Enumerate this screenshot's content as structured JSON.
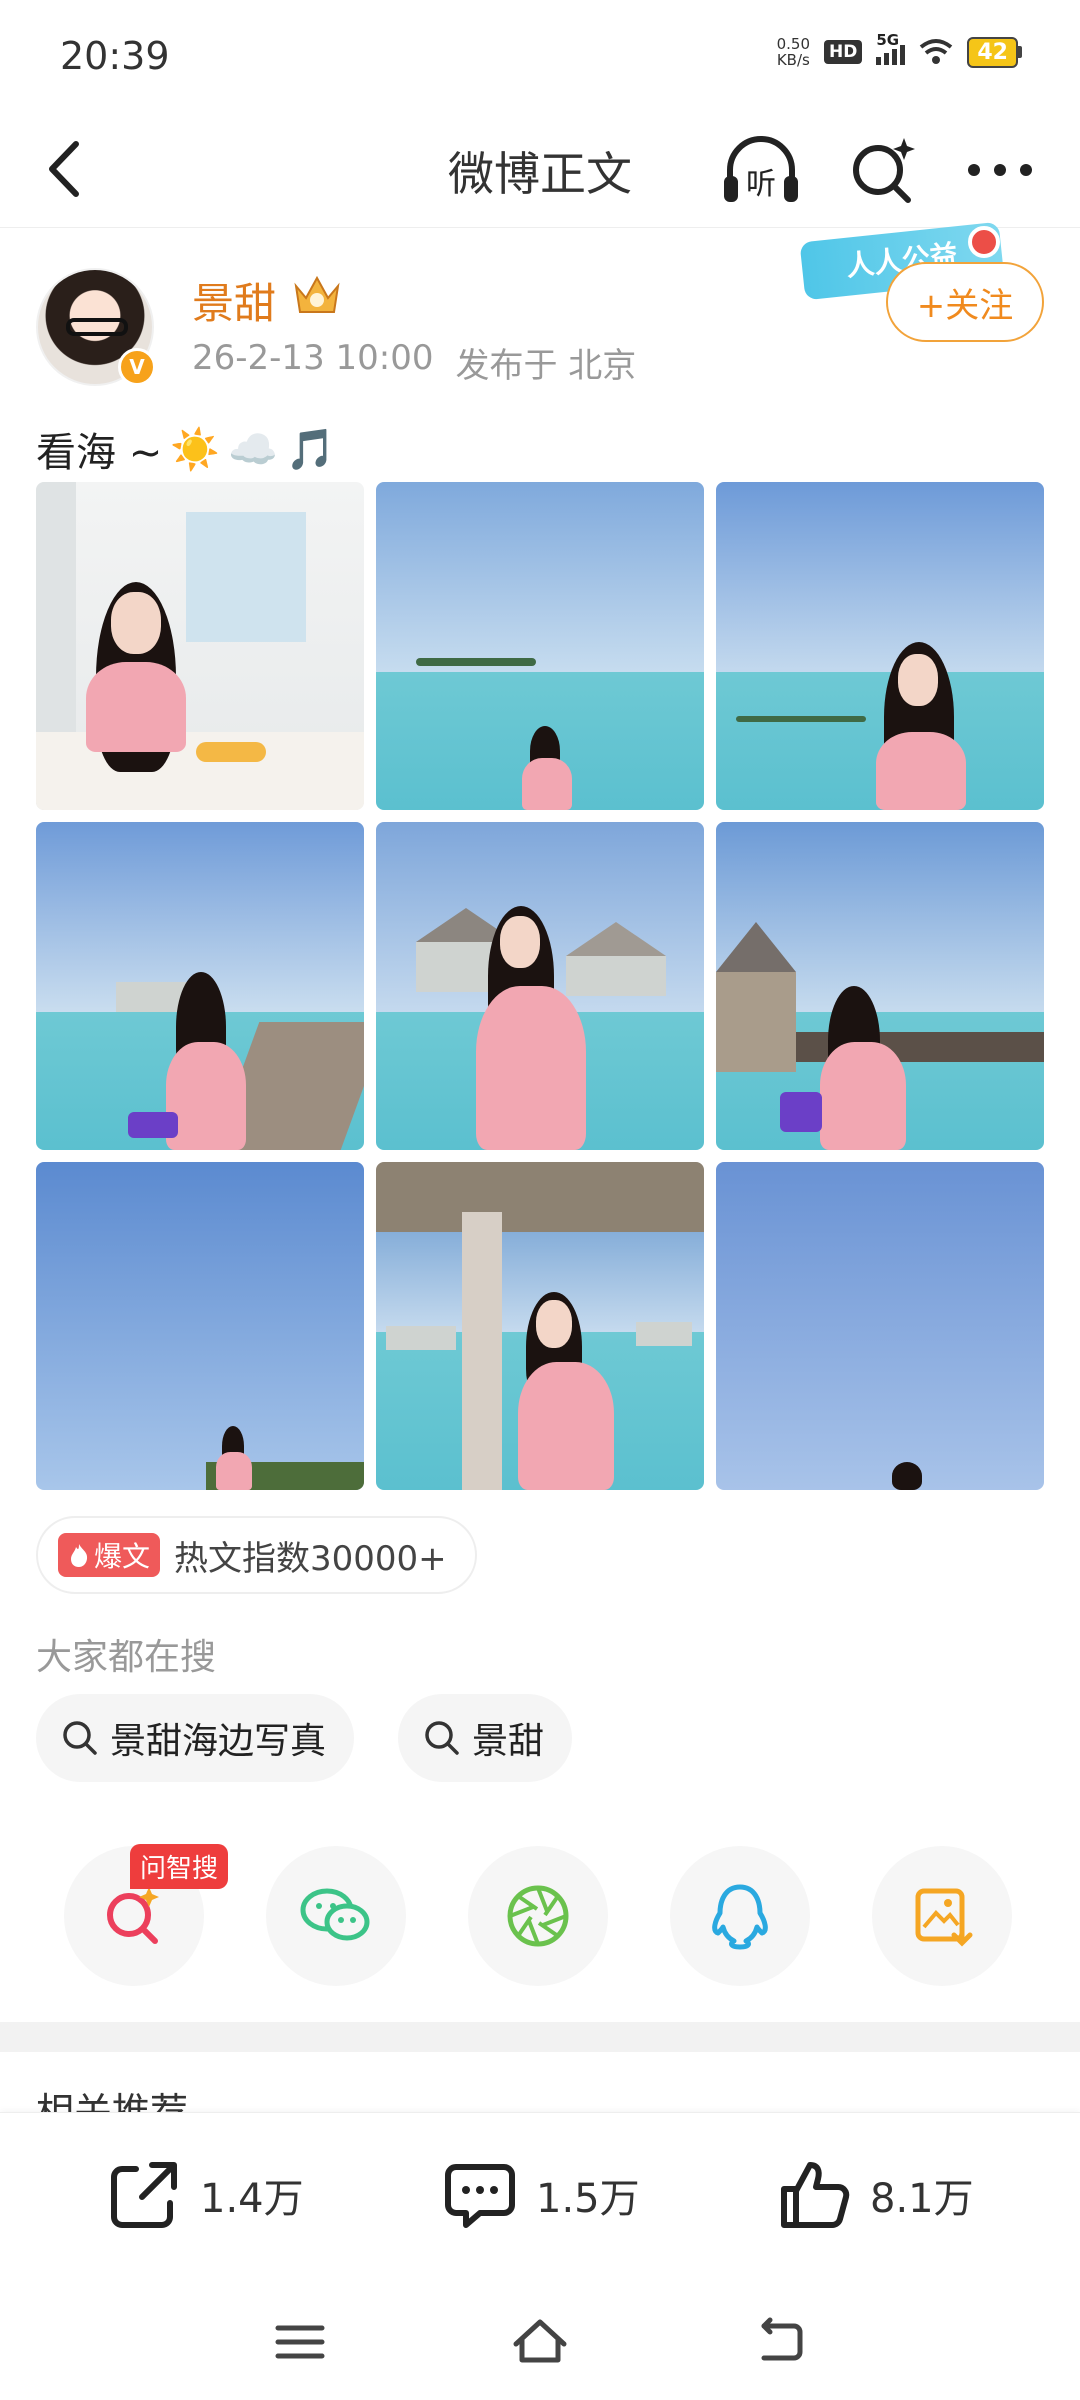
{
  "status_bar": {
    "time": "20:39",
    "net_speed_value": "0.50",
    "net_speed_unit": "KB/s",
    "hd": "HD",
    "network": "5G",
    "battery": "42"
  },
  "nav": {
    "title": "微博正文",
    "listen_label": "听"
  },
  "author": {
    "name": "景甜",
    "verified_mark": "V",
    "date": "26-2-13 10:00",
    "location": "发布于 北京",
    "follow_label": "+关注",
    "campaign_text": "人人公益"
  },
  "post": {
    "text": "看海 ~",
    "emojis": [
      "☀️",
      "☁️",
      "🎵"
    ],
    "photo_count": 9
  },
  "hot": {
    "badge": "爆文",
    "text": "热文指数30000+"
  },
  "search_section": {
    "title": "大家都在搜",
    "chips": [
      "景甜海边写真",
      "景甜"
    ]
  },
  "share": {
    "ask_badge": "问智搜",
    "items": [
      "ai-search",
      "wechat",
      "moments",
      "qq",
      "save-image"
    ],
    "colors": {
      "ai": "#ec3f5c",
      "wechat": "#3cc488",
      "moments": "#6ac24d",
      "qq": "#2aa9e0",
      "save": "#f5a623"
    }
  },
  "related": {
    "title": "相关推荐"
  },
  "actions": {
    "repost": "1.4万",
    "comment": "1.5万",
    "like": "8.1万"
  },
  "colors": {
    "accent": "#f08a1e",
    "name": "#e07b1c",
    "hot_badge": "#ef5a5a"
  }
}
